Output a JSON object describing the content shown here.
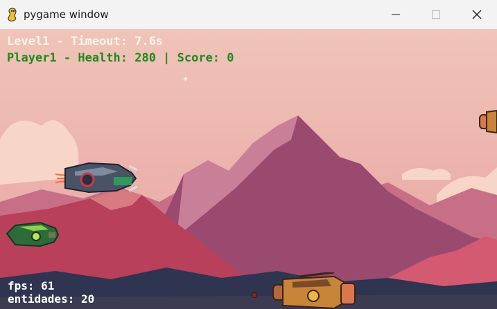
{
  "window": {
    "title": "pygame window",
    "app_icon": "pygame-snake-icon",
    "controls": [
      "minimize-icon",
      "maximize-icon",
      "close-icon"
    ]
  },
  "hud": {
    "level_line": "Level1 - Timeout: 7.6s",
    "player_line": "Player1 - Health: 280 | Score: 0",
    "fps_line": "fps: 61",
    "entities_line": "entidades: 20"
  },
  "state": {
    "level": 1,
    "timeout_seconds": 7.6,
    "player": "Player1",
    "health": 280,
    "score": 0,
    "fps": 61,
    "entities": 20
  },
  "colors": {
    "sky": "#eab0a8",
    "sky_top": "#f0c4b8",
    "mountain_main": "#9a4a6e",
    "mountain_far": "#c76f86",
    "mountain_red": "#b8405a",
    "hills_dark": "#2f3450",
    "hud_white": "#fff4ec",
    "hud_green": "#1f8a1f"
  }
}
